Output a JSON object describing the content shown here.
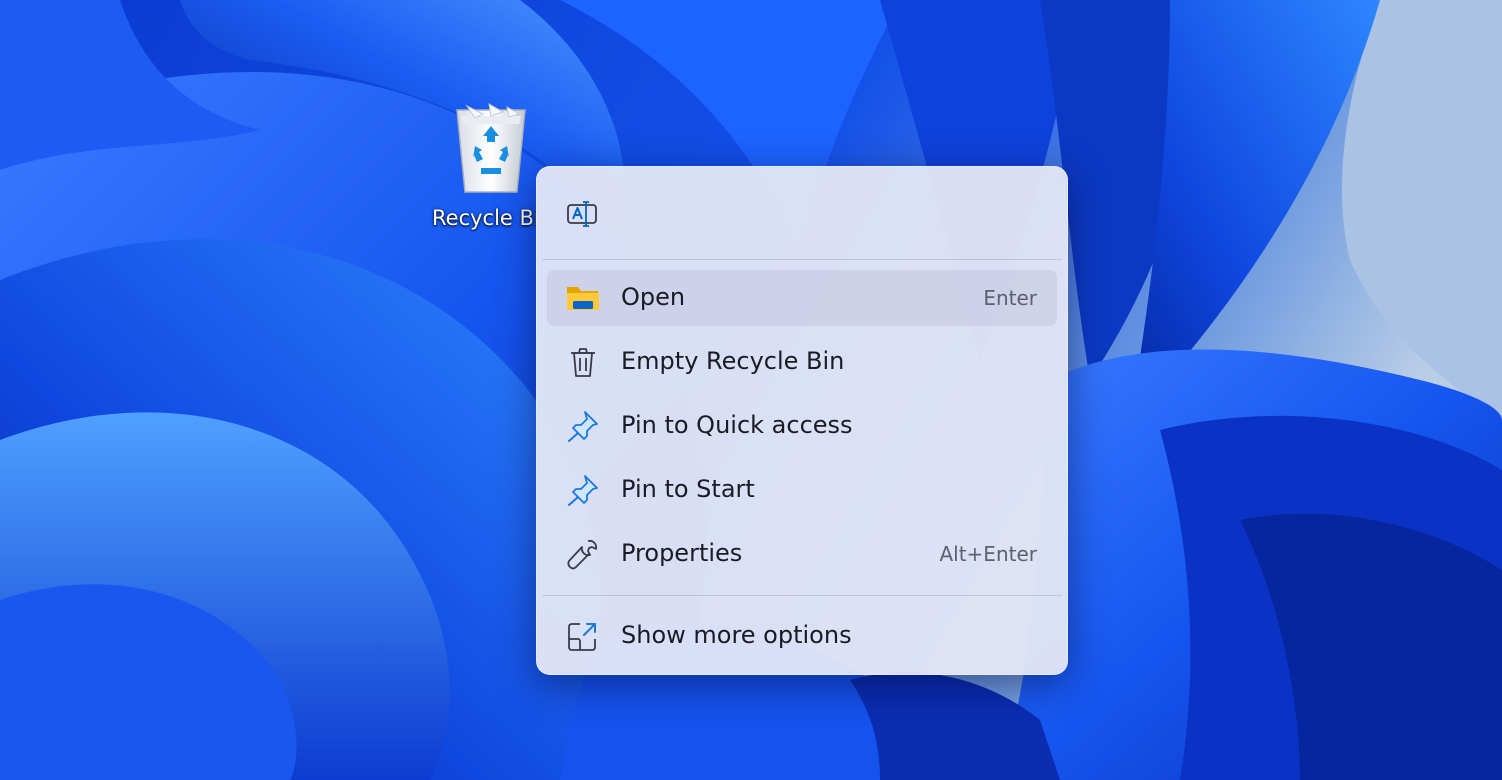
{
  "desktop": {
    "wallpaper": "windows-11-bloom",
    "icons": [
      {
        "label": "Recycle Bi",
        "icon": "recycle-bin-icon"
      }
    ]
  },
  "context_menu": {
    "top_actions": [
      {
        "icon": "rename-icon"
      }
    ],
    "items": [
      {
        "label": "Open",
        "shortcut": "Enter",
        "icon": "folder-icon",
        "highlighted": true
      },
      {
        "label": "Empty Recycle Bin",
        "shortcut": "",
        "icon": "trash-icon"
      },
      {
        "label": "Pin to Quick access",
        "shortcut": "",
        "icon": "pin-icon"
      },
      {
        "label": "Pin to Start",
        "shortcut": "",
        "icon": "pin-icon"
      },
      {
        "label": "Properties",
        "shortcut": "Alt+Enter",
        "icon": "wrench-icon"
      }
    ],
    "footer_item": {
      "label": "Show more options",
      "icon": "share-icon"
    }
  },
  "colors": {
    "accent": "#0067c0",
    "folder_yellow": "#f5bd1f",
    "menu_background": "#e2e5f6",
    "wallpaper_blue": "#0b3fd8"
  }
}
